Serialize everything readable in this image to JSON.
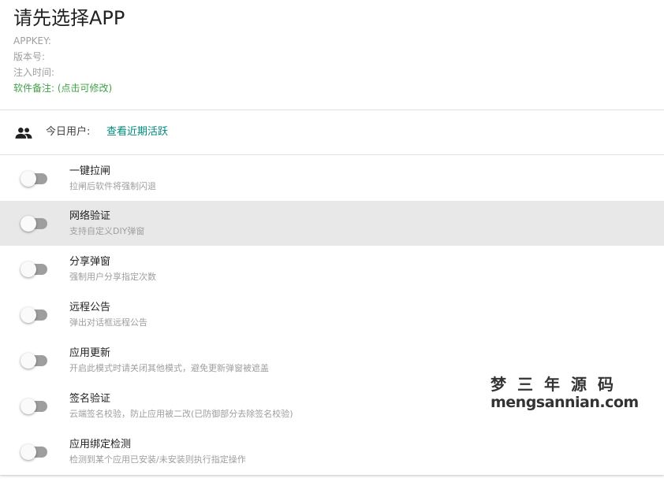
{
  "header": {
    "title": "请先选择APP",
    "appkey_label": "APPKEY:",
    "version_label": "版本号:",
    "inject_time_label": "注入时间:",
    "remark_label": "软件备注: (点击可修改)"
  },
  "users": {
    "icon": "people-icon",
    "label": "今日用户:",
    "link": "查看近期活跃"
  },
  "settings": [
    {
      "title": "一键拉闸",
      "subtitle": "拉闸后软件将强制闪退",
      "enabled": false
    },
    {
      "title": "网络验证",
      "subtitle": "支持自定义DIY弹窗",
      "enabled": false
    },
    {
      "title": "分享弹窗",
      "subtitle": "强制用户分享指定次数",
      "enabled": false
    },
    {
      "title": "远程公告",
      "subtitle": "弹出对话框远程公告",
      "enabled": false
    },
    {
      "title": "应用更新",
      "subtitle": "开启此模式时请关闭其他模式，避免更新弹窗被遮盖",
      "enabled": false
    },
    {
      "title": "签名验证",
      "subtitle": "云端签名校验，防止应用被二改(已防御部分去除签名校验)",
      "enabled": false
    },
    {
      "title": "应用绑定检测",
      "subtitle": "检测到某个应用已安装/未安装则执行指定操作",
      "enabled": false
    }
  ],
  "watermark": {
    "chinese": "梦三年源码",
    "domain": "mengsannian.com"
  },
  "colors": {
    "remark_green": "#43a047",
    "link_teal": "#00897b",
    "highlight_row": "#e8e8e8",
    "toggle_track_off": "#9e9e9e"
  }
}
